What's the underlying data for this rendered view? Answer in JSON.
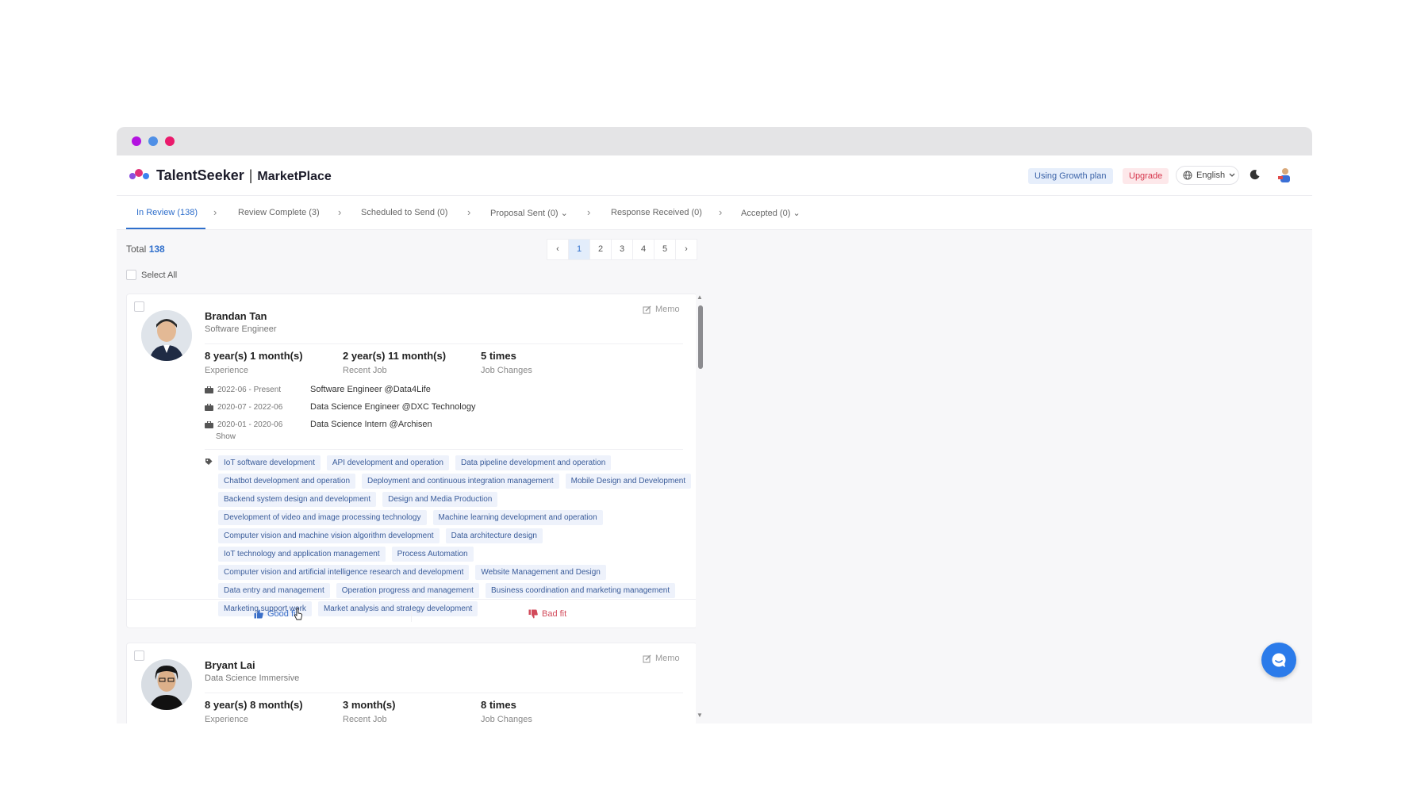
{
  "app": {
    "brand": "TalentSeeker",
    "separator": "|",
    "section": "MarketPlace"
  },
  "header": {
    "plan_badge": "Using Growth plan",
    "upgrade_label": "Upgrade",
    "language": "English",
    "icons": [
      "globe-icon",
      "chevron-down-icon",
      "moon-icon",
      "user-avatar"
    ]
  },
  "stepper": {
    "steps": [
      {
        "label": "In Review (138)",
        "active": true
      },
      {
        "label": "Review Complete (3)"
      },
      {
        "label": "Scheduled to Send (0)"
      },
      {
        "label": "Proposal Sent (0)",
        "dropdown": true
      },
      {
        "label": "Response Received (0)"
      },
      {
        "label": "Accepted (0)",
        "dropdown": true
      }
    ]
  },
  "list_header": {
    "total_label": "Total",
    "total_value": "138",
    "select_all": "Select All"
  },
  "pagination": {
    "prev": "‹",
    "pages": [
      "1",
      "2",
      "3",
      "4",
      "5"
    ],
    "current": "1",
    "next": "›"
  },
  "candidates": [
    {
      "name": "Brandan Tan",
      "role": "Software Engineer",
      "memo": "Memo",
      "stats": [
        {
          "value": "8 year(s) 1 month(s)",
          "label": "Experience"
        },
        {
          "value": "2 year(s) 11 month(s)",
          "label": "Recent Job"
        },
        {
          "value": "5 times",
          "label": "Job Changes"
        }
      ],
      "jobs": [
        {
          "dates": "2022-06 - Present",
          "title": "Software Engineer @Data4Life"
        },
        {
          "dates": "2020-07 - 2022-06",
          "title": "Data Science Engineer @DXC Technology"
        },
        {
          "dates": "2020-01 - 2020-06",
          "title": "Data Science Intern @Archisen"
        }
      ],
      "show_label": "Show",
      "tags": [
        "IoT software development",
        "API development and operation",
        "Data pipeline development and operation",
        "Chatbot development and operation",
        "Deployment and continuous integration management",
        "Mobile Design and Development",
        "Backend system design and development",
        "Design and Media Production",
        "Development of video and image processing technology",
        "Machine learning development and operation",
        "Computer vision and machine vision algorithm development",
        "Data architecture design",
        "IoT technology and application management",
        "Process Automation",
        "Computer vision and artificial intelligence research and development",
        "Website Management and Design",
        "Data entry and management",
        "Operation progress and management",
        "Business coordination and marketing management",
        "Marketing support work",
        "Market analysis and strategy development"
      ],
      "good_fit": "Good fit",
      "bad_fit": "Bad fit"
    },
    {
      "name": "Bryant Lai",
      "role": "Data Science Immersive",
      "memo": "Memo",
      "stats": [
        {
          "value": "8 year(s) 8 month(s)",
          "label": "Experience"
        },
        {
          "value": "3 month(s)",
          "label": "Recent Job"
        },
        {
          "value": "8 times",
          "label": "Job Changes"
        }
      ]
    }
  ],
  "colors": {
    "accent": "#2f6fcc",
    "upgrade": "#d6344a",
    "chat": "#2b7bea"
  }
}
